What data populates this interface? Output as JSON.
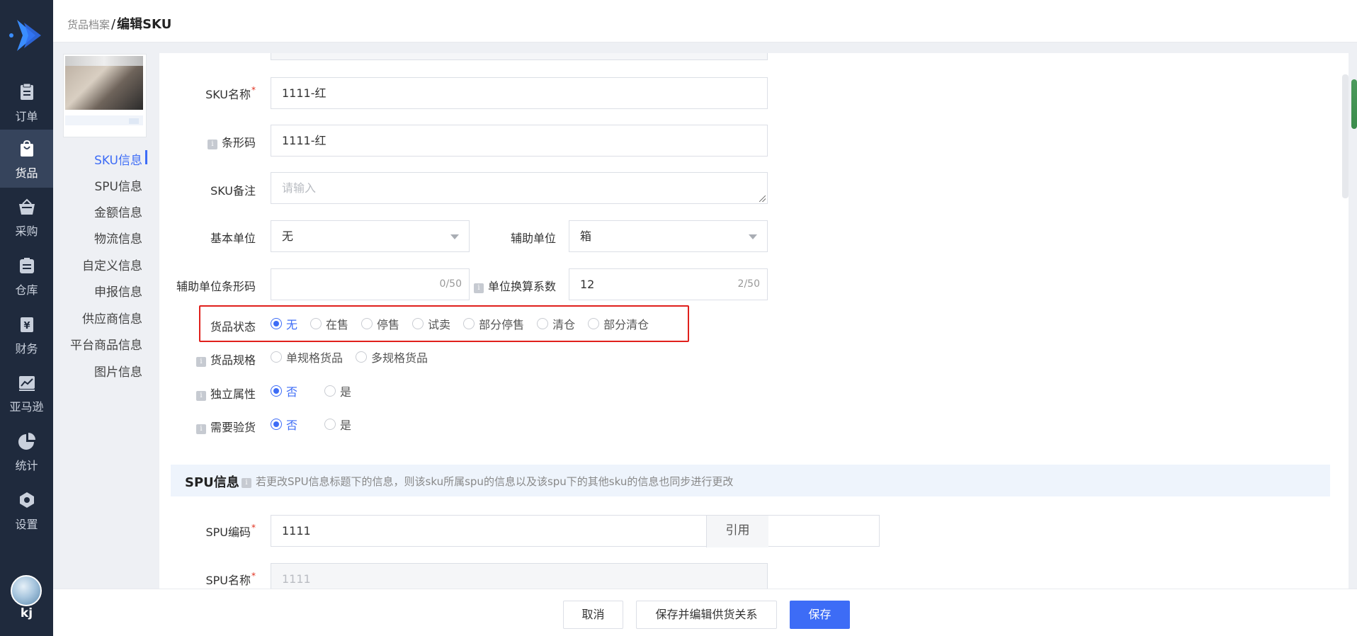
{
  "nav": {
    "items": [
      {
        "label": "订单",
        "icon": "clipboard-icon"
      },
      {
        "label": "货品",
        "icon": "shopping-bag-icon"
      },
      {
        "label": "采购",
        "icon": "basket-icon"
      },
      {
        "label": "仓库",
        "icon": "warehouse-icon"
      },
      {
        "label": "财务",
        "icon": "yen-icon"
      },
      {
        "label": "亚马逊",
        "icon": "line-chart-icon"
      },
      {
        "label": "统计",
        "icon": "pie-chart-icon"
      },
      {
        "label": "设置",
        "icon": "hexagon-gear-icon"
      }
    ],
    "active": "货品",
    "user": "kj"
  },
  "breadcrumb": {
    "parent": "货品档案",
    "separator": "/",
    "current": "编辑SKU"
  },
  "subnav": {
    "items": [
      "SKU信息",
      "SPU信息",
      "金额信息",
      "物流信息",
      "自定义信息",
      "申报信息",
      "供应商信息",
      "平台商品信息",
      "图片信息"
    ],
    "active": "SKU信息"
  },
  "form": {
    "sku_name": {
      "label": "SKU名称",
      "value": "1111-红",
      "required": true
    },
    "barcode": {
      "label": "条形码",
      "value": "1111-红"
    },
    "sku_remark": {
      "label": "SKU备注",
      "placeholder": "请输入"
    },
    "base_unit": {
      "label": "基本单位",
      "value": "无"
    },
    "aux_unit": {
      "label": "辅助单位",
      "value": "箱"
    },
    "aux_unit_barcode": {
      "label": "辅助单位条形码",
      "value": "",
      "counter": "0/50"
    },
    "unit_conversion": {
      "label": "单位换算系数",
      "value": "12",
      "counter": "2/50"
    },
    "goods_status": {
      "label": "货品状态",
      "options": [
        "无",
        "在售",
        "停售",
        "试卖",
        "部分停售",
        "清仓",
        "部分清仓"
      ],
      "selected": "无"
    },
    "goods_spec": {
      "label": "货品规格",
      "options": [
        "单规格货品",
        "多规格货品"
      ],
      "selected": ""
    },
    "independent_attr": {
      "label": "独立属性",
      "options": [
        "否",
        "是"
      ],
      "selected": "否"
    },
    "need_inspection": {
      "label": "需要验货",
      "options": [
        "否",
        "是"
      ],
      "selected": "否"
    }
  },
  "spu_section": {
    "title": "SPU信息",
    "note": "若更改SPU信息标题下的信息，则该sku所属spu的信息以及该spu下的其他sku的信息也同步进行更改",
    "spu_code": {
      "label": "SPU编码",
      "value": "1111",
      "required": true,
      "button": "引用"
    },
    "spu_name": {
      "label": "SPU名称",
      "value": "1111",
      "required": true
    }
  },
  "footer": {
    "cancel": "取消",
    "save_edit_supplier": "保存并编辑供货关系",
    "save": "保存"
  },
  "colors": {
    "sidebar": "#1f2a3d",
    "accent": "#3d6cf6",
    "highlight": "#e0201c"
  }
}
